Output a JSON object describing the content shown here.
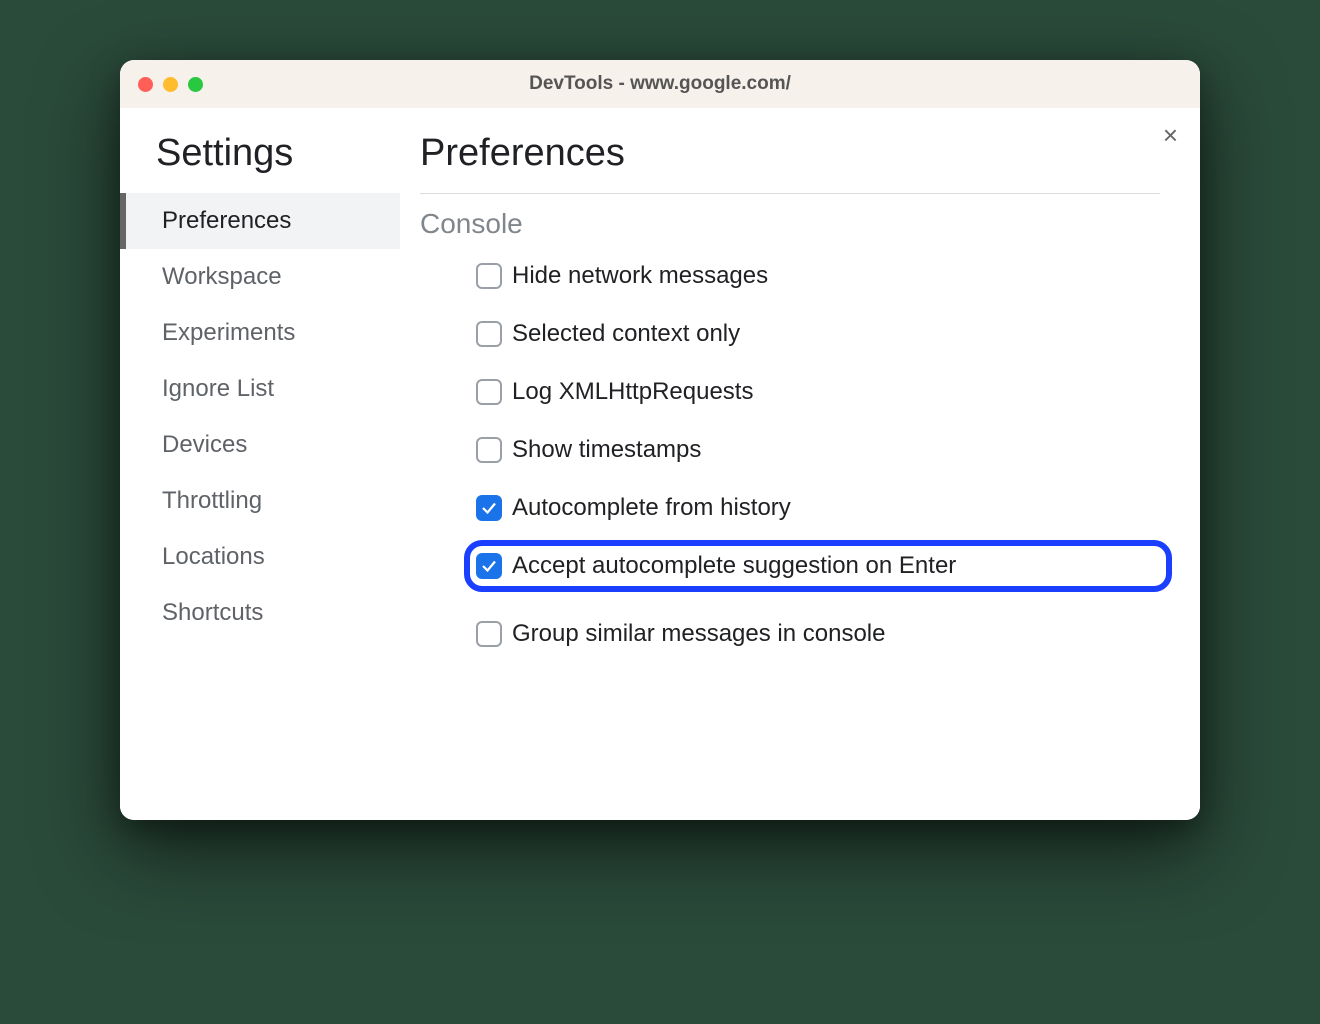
{
  "window": {
    "title": "DevTools - www.google.com/"
  },
  "sidebar": {
    "title": "Settings",
    "items": [
      {
        "label": "Preferences",
        "active": true
      },
      {
        "label": "Workspace",
        "active": false
      },
      {
        "label": "Experiments",
        "active": false
      },
      {
        "label": "Ignore List",
        "active": false
      },
      {
        "label": "Devices",
        "active": false
      },
      {
        "label": "Throttling",
        "active": false
      },
      {
        "label": "Locations",
        "active": false
      },
      {
        "label": "Shortcuts",
        "active": false
      }
    ]
  },
  "main": {
    "title": "Preferences",
    "section": "Console",
    "options": [
      {
        "label": "Hide network messages",
        "checked": false,
        "highlighted": false
      },
      {
        "label": "Selected context only",
        "checked": false,
        "highlighted": false
      },
      {
        "label": "Log XMLHttpRequests",
        "checked": false,
        "highlighted": false
      },
      {
        "label": "Show timestamps",
        "checked": false,
        "highlighted": false
      },
      {
        "label": "Autocomplete from history",
        "checked": true,
        "highlighted": false
      },
      {
        "label": "Accept autocomplete suggestion on Enter",
        "checked": true,
        "highlighted": true
      },
      {
        "label": "Group similar messages in console",
        "checked": false,
        "highlighted": false
      }
    ]
  }
}
